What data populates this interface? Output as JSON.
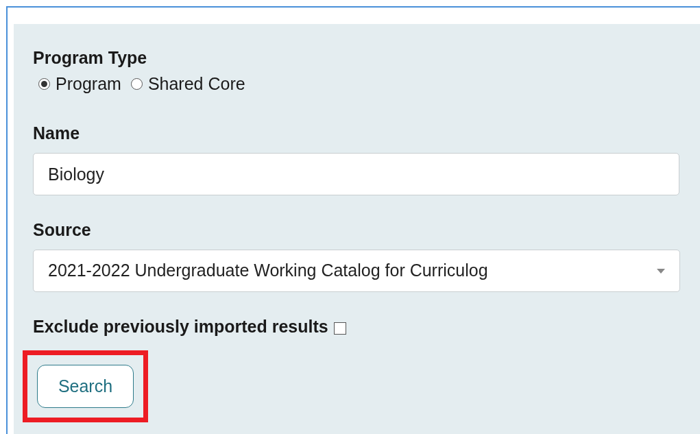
{
  "program_type": {
    "label": "Program Type",
    "options": [
      {
        "label": "Program",
        "selected": true
      },
      {
        "label": "Shared Core",
        "selected": false
      }
    ]
  },
  "name": {
    "label": "Name",
    "value": "Biology"
  },
  "source": {
    "label": "Source",
    "value": "2021-2022 Undergraduate Working Catalog for Curriculog"
  },
  "exclude": {
    "label": "Exclude previously imported results",
    "checked": false
  },
  "search_button": {
    "label": "Search",
    "highlighted": true
  }
}
